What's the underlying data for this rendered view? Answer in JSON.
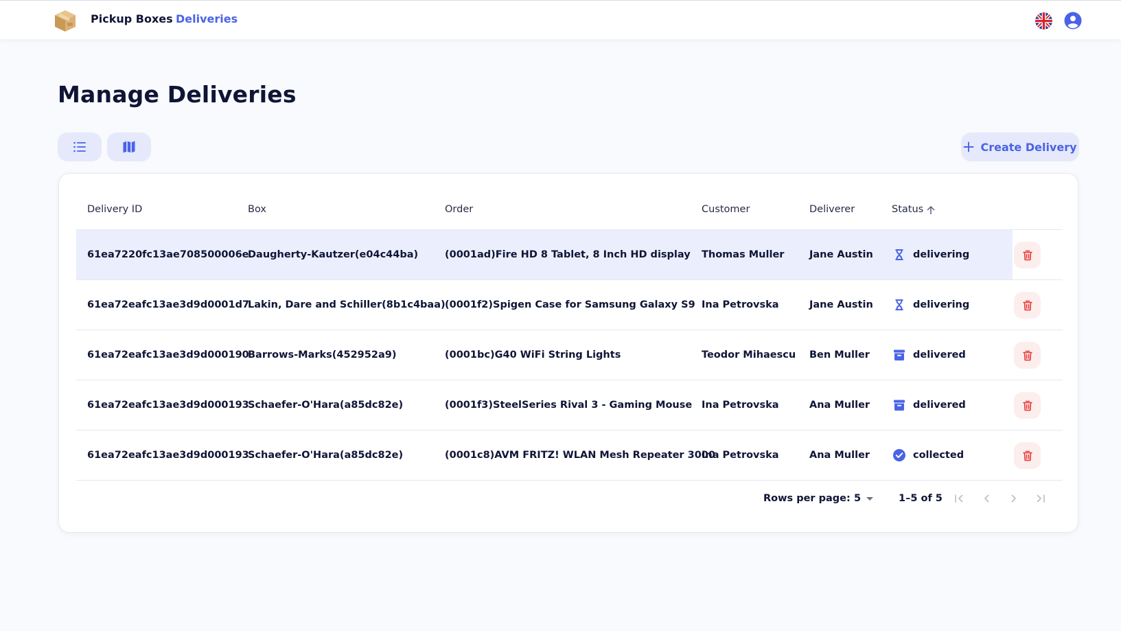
{
  "header": {
    "brand": "Pickup Boxes",
    "nav_deliveries": "Deliveries"
  },
  "page": {
    "title": "Manage Deliveries",
    "create_label": "Create Delivery"
  },
  "table": {
    "columns": {
      "delivery_id": "Delivery ID",
      "box": "Box",
      "order": "Order",
      "customer": "Customer",
      "deliverer": "Deliverer",
      "status": "Status"
    },
    "rows": [
      {
        "id": "61ea7220fc13ae708500006e",
        "box": "Daugherty-Kautzer(e04c44ba)",
        "order": "(0001ad)Fire HD 8 Tablet, 8 Inch HD display",
        "customer": "Thomas Muller",
        "deliverer": "Jane Austin",
        "status": "delivering",
        "status_icon": "hourglass-icon"
      },
      {
        "id": "61ea72eafc13ae3d9d0001d7",
        "box": "Lakin, Dare and Schiller(8b1c4baa)",
        "order": "(0001f2)Spigen Case for Samsung Galaxy S9",
        "customer": "Ina Petrovska",
        "deliverer": "Jane Austin",
        "status": "delivering",
        "status_icon": "hourglass-icon"
      },
      {
        "id": "61ea72eafc13ae3d9d000190",
        "box": "Barrows-Marks(452952a9)",
        "order": "(0001bc)G40 WiFi String Lights",
        "customer": "Teodor Mihaescu",
        "deliverer": "Ben Muller",
        "status": "delivered",
        "status_icon": "archive-box-icon"
      },
      {
        "id": "61ea72eafc13ae3d9d000193",
        "box": "Schaefer-O'Hara(a85dc82e)",
        "order": "(0001f3)SteelSeries Rival 3 - Gaming Mouse",
        "customer": "Ina Petrovska",
        "deliverer": "Ana Muller",
        "status": "delivered",
        "status_icon": "archive-box-icon"
      },
      {
        "id": "61ea72eafc13ae3d9d000193",
        "box": "Schaefer-O'Hara(a85dc82e)",
        "order": "(0001c8)AVM FRITZ! WLAN Mesh Repeater 3000",
        "customer": "Ina Petrovska",
        "deliverer": "Ana Muller",
        "status": "collected",
        "status_icon": "check-circle-icon"
      }
    ]
  },
  "pagination": {
    "rows_per_page_label": "Rows per page:",
    "rows_per_page_value": "5",
    "range": "1–5 of 5"
  },
  "colors": {
    "accent": "#4a63e6",
    "danger": "#e53935",
    "highlight_row": "#ebeffd"
  }
}
